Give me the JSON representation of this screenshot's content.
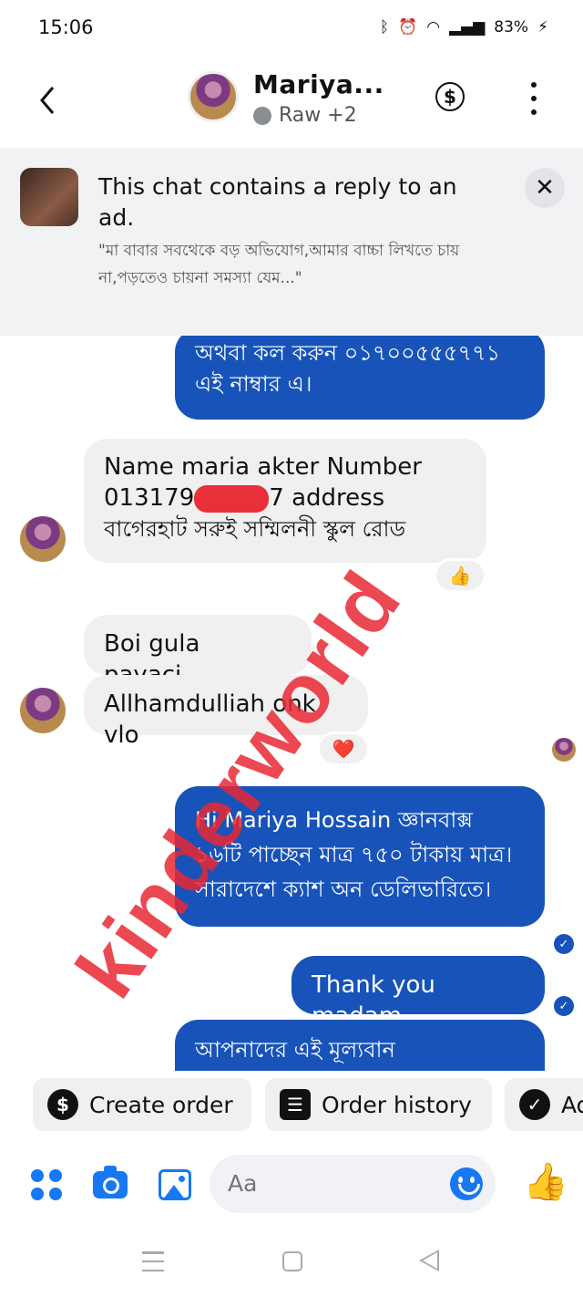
{
  "status_bar": {
    "time": "15:06",
    "battery": "83%"
  },
  "header": {
    "contact_name": "Mariya...",
    "presence": "Raw +2"
  },
  "ad_banner": {
    "title": "This chat contains a reply to an ad.",
    "quote": "\"মা বাবার সবথেকে বড় অভিযোগ,আমার বাচ্চা লিখতে চায় না,পড়তেও চায়না সমস্যা যেম...\""
  },
  "messages": [
    {
      "side": "out",
      "text": "অথবা কল করুন ০১৭০০৫৫৫৭৭১ এই নাম্বার এ।"
    },
    {
      "side": "in",
      "line1": "Name maria akter Number",
      "line2_start": "013179",
      "line2_end": "7 address",
      "line3": "বাগেরহাট সরুই সম্মিলনী স্কুল রোড",
      "reaction": "👍"
    },
    {
      "side": "in",
      "text": "Boi gula payaci.."
    },
    {
      "side": "in",
      "text": "Allhamdulliah onk vlo",
      "reaction": "❤️"
    },
    {
      "side": "out",
      "text": "Hi Mariya Hossain  জ্ঞানবাক্স ১৬টি পাচ্ছেন মাত্র ৭৫০ টাকায় মাত্র। সারাদেশে ক্যাশ অন ডেলিভারিতে।"
    },
    {
      "side": "out",
      "text": "Thank you madam"
    },
    {
      "side": "out",
      "text": "আপনাদের এই মূল্যবান"
    }
  ],
  "watermark": "kinderworld",
  "quick_actions": [
    {
      "label": "Create order",
      "icon": "dollar-icon"
    },
    {
      "label": "Order history",
      "icon": "receipt-icon"
    },
    {
      "label": "Ad",
      "icon": "check-circle-icon"
    }
  ],
  "composer": {
    "placeholder": "Aa"
  },
  "colors": {
    "accent": "#1877f2",
    "outgoing_bubble": "#1753b8",
    "incoming_bubble": "#f0f0f0",
    "watermark": "#e82832"
  }
}
